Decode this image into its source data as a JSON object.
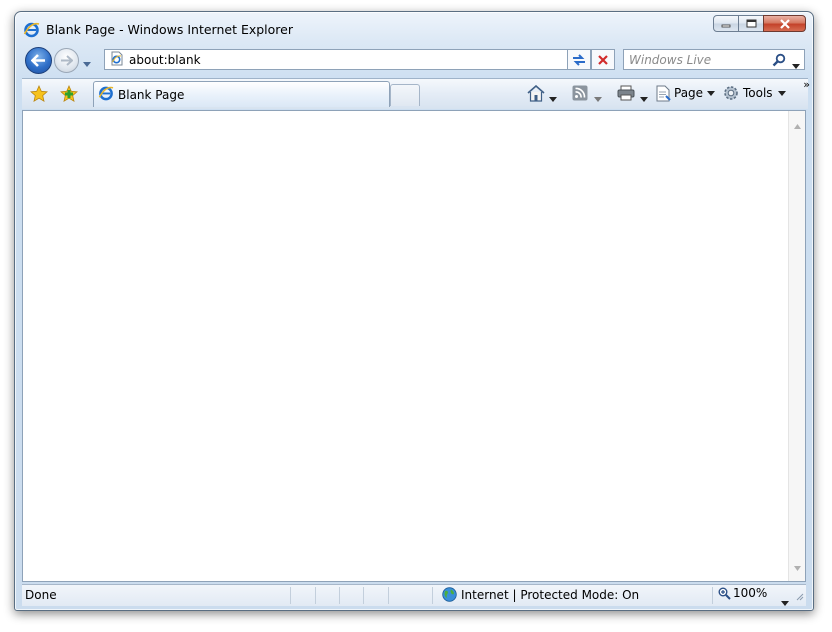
{
  "window": {
    "title": "Blank Page - Windows Internet Explorer",
    "caption_buttons": [
      "minimize",
      "maximize",
      "close"
    ]
  },
  "navigation": {
    "address_value": "about:blank",
    "search_placeholder": "Windows Live"
  },
  "tabs": [
    {
      "label": "Blank Page",
      "active": true
    }
  ],
  "command_bar": {
    "page_label": "Page",
    "tools_label": "Tools",
    "more_label": "»"
  },
  "status_bar": {
    "status_text": "Done",
    "zone_text": "Internet | Protected Mode: On",
    "zoom_text": "100%"
  },
  "colors": {
    "accent": "#2f6fc8",
    "close_button": "#c4432a"
  }
}
